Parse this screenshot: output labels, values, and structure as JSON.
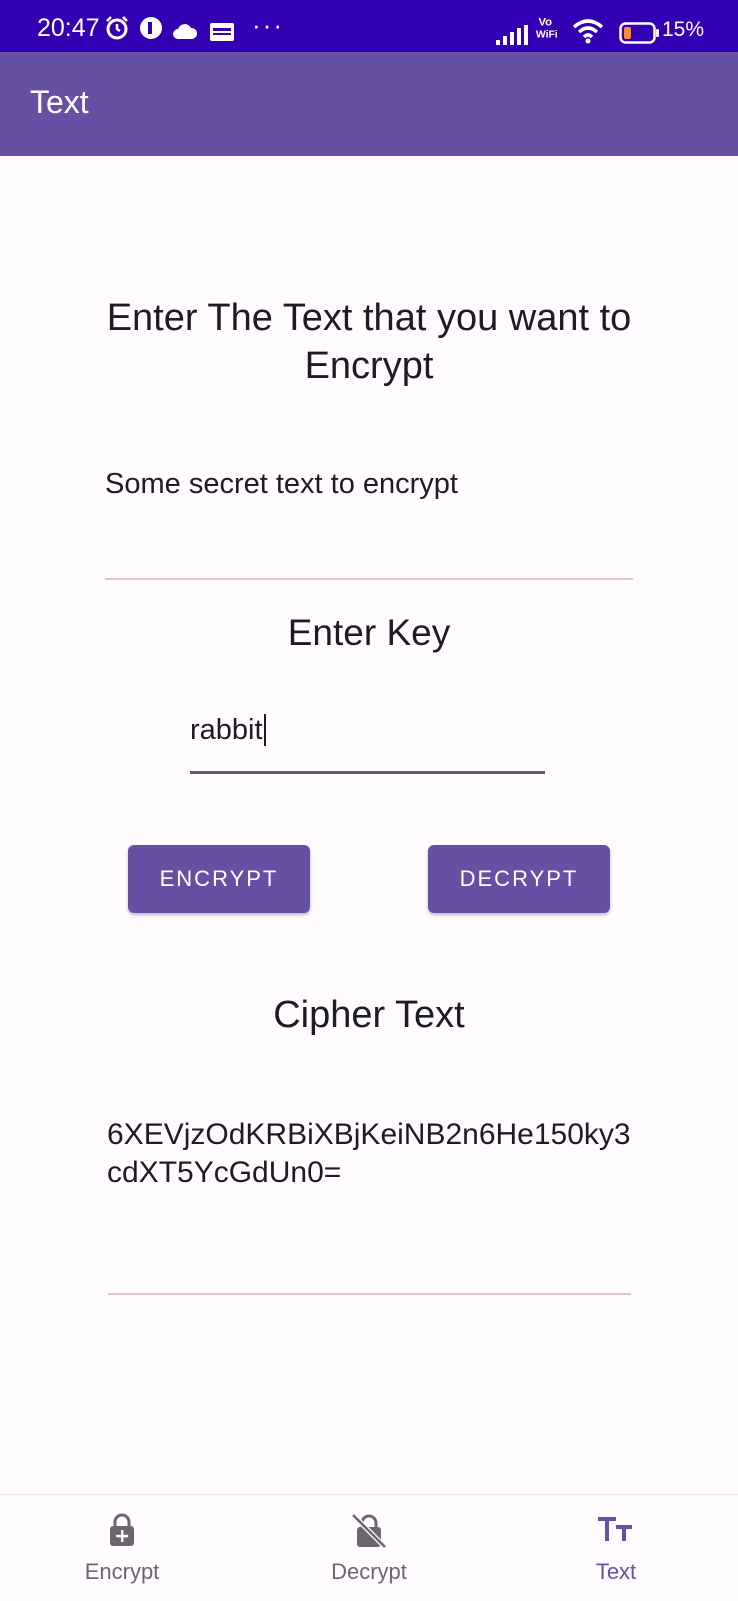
{
  "status_bar": {
    "time": "20:47",
    "more": "···",
    "battery_percent": "15%",
    "network_label": "Vo WiFi",
    "colors": {
      "background": "#3300b3"
    }
  },
  "app_bar": {
    "title": "Text",
    "colors": {
      "background": "#6750a4"
    }
  },
  "main": {
    "plaintext_heading": "Enter The Text that you want to Encrypt",
    "plaintext_value": "Some secret text to encrypt",
    "key_heading": "Enter Key",
    "key_value": "rabbit",
    "encrypt_button": "ENCRYPT",
    "decrypt_button": "DECRYPT",
    "cipher_heading": "Cipher Text",
    "cipher_value": "6XEVjzOdKRBiXBjKeiNB2n6He150ky3cdXT5YcGdUn0="
  },
  "bottom_nav": {
    "items": [
      {
        "label": "Encrypt",
        "icon": "lock-plus-icon",
        "active": false
      },
      {
        "label": "Decrypt",
        "icon": "lock-off-icon",
        "active": false
      },
      {
        "label": "Text",
        "icon": "text-format-icon",
        "active": true
      }
    ],
    "colors": {
      "active": "#6750a4",
      "inactive": "#6b6670"
    }
  }
}
